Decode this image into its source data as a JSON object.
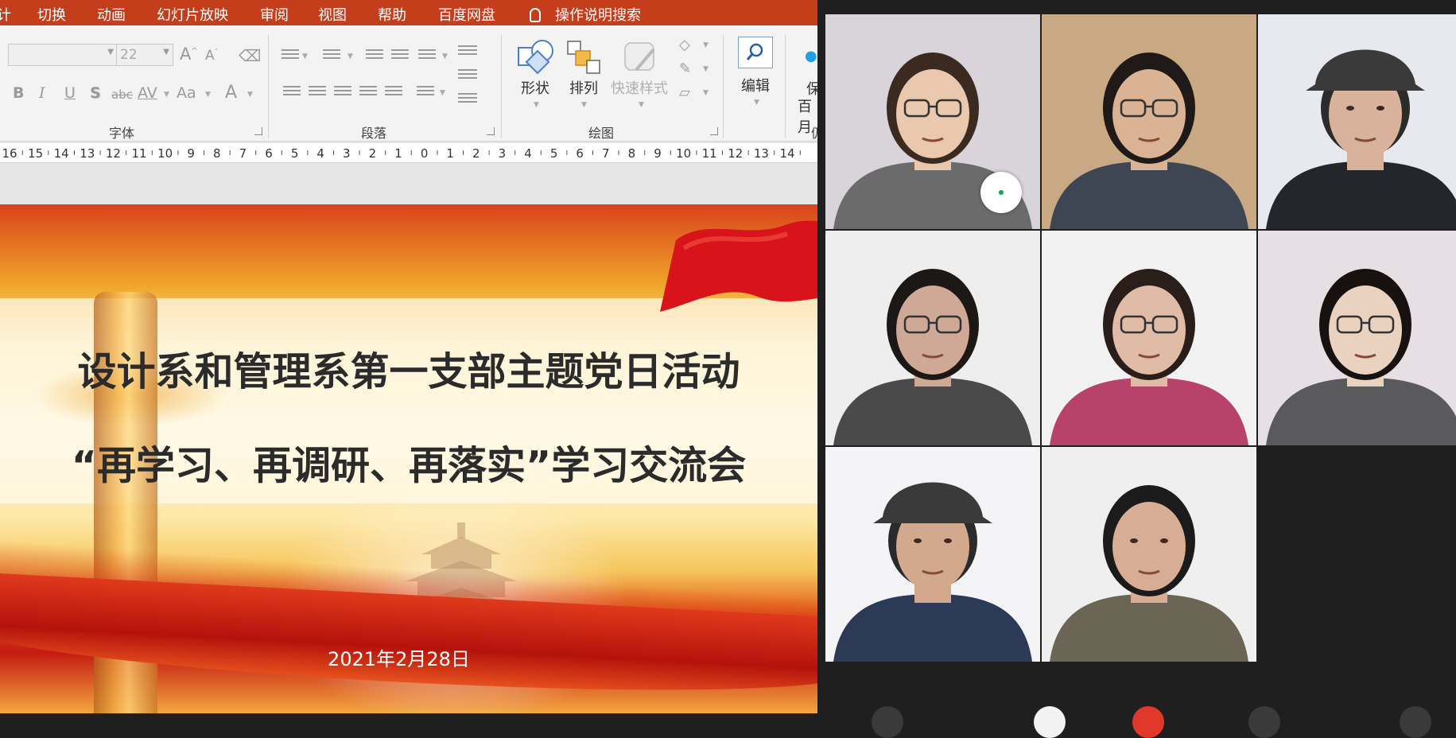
{
  "menu": {
    "items": [
      "计",
      "切换",
      "动画",
      "幻灯片放映",
      "审阅",
      "视图",
      "帮助",
      "百度网盘"
    ],
    "tell_me": "操作说明搜索"
  },
  "ribbon": {
    "font_size": "22",
    "font_group_label": "字体",
    "paragraph_group_label": "段落",
    "drawing_group_label": "绘图",
    "shape_label": "形状",
    "arrange_label": "排列",
    "quick_style_label": "快速样式",
    "edit_label": "编辑",
    "save_label_1": "保",
    "save_label_2": "百月",
    "next_group_label": "仍",
    "font_btns": {
      "bold": "B",
      "italic": "I",
      "underline": "U",
      "shadow": "S",
      "strike": "abc",
      "spacing": "AV",
      "case": "Aa",
      "color": "A",
      "grow": "A",
      "shrink": "A"
    }
  },
  "ruler": {
    "labels": [
      "16",
      "15",
      "14",
      "13",
      "12",
      "11",
      "10",
      "9",
      "8",
      "7",
      "6",
      "5",
      "4",
      "3",
      "2",
      "1",
      "0",
      "1",
      "2",
      "3",
      "4",
      "5",
      "6",
      "7",
      "8",
      "9",
      "10",
      "11",
      "12",
      "13",
      "14"
    ]
  },
  "slide": {
    "title_line1": "设计系和管理系第一支部主题党日活动",
    "title_line2": "“再学习、再调研、再落实”学习交流会",
    "date": "2021年2月28日"
  },
  "participants": [
    {
      "skin": "#e9c8ad",
      "hair": "#3a2a20",
      "cloth": "#6b6b6b",
      "bg": "#d8d4da",
      "glasses": true,
      "cap": false
    },
    {
      "skin": "#d9b394",
      "hair": "#1f1a18",
      "cloth": "#3e4654",
      "bg": "#c9a984",
      "glasses": true,
      "cap": false
    },
    {
      "skin": "#d8b29a",
      "hair": "#2b2b2b",
      "cloth": "#24262b",
      "bg": "#e7e9ee",
      "glasses": false,
      "cap": true
    },
    {
      "skin": "#cfa996",
      "hair": "#1c1816",
      "cloth": "#4a4a4a",
      "bg": "#eeeeee",
      "glasses": true,
      "cap": false
    },
    {
      "skin": "#e0bca6",
      "hair": "#2a1e1a",
      "cloth": "#b8426a",
      "bg": "#f2f2f2",
      "glasses": true,
      "cap": false
    },
    {
      "skin": "#ead2c0",
      "hair": "#17120f",
      "cloth": "#5a5a5c",
      "bg": "#e6dfe4",
      "glasses": true,
      "cap": false
    },
    {
      "skin": "#d3a98e",
      "hair": "#2a2a2a",
      "cloth": "#2c3a58",
      "bg": "#f4f4f6",
      "glasses": false,
      "cap": true
    },
    {
      "skin": "#d7ae93",
      "hair": "#1b1b1b",
      "cloth": "#6a6554",
      "bg": "#f0efef",
      "glasses": false,
      "cap": false
    }
  ]
}
